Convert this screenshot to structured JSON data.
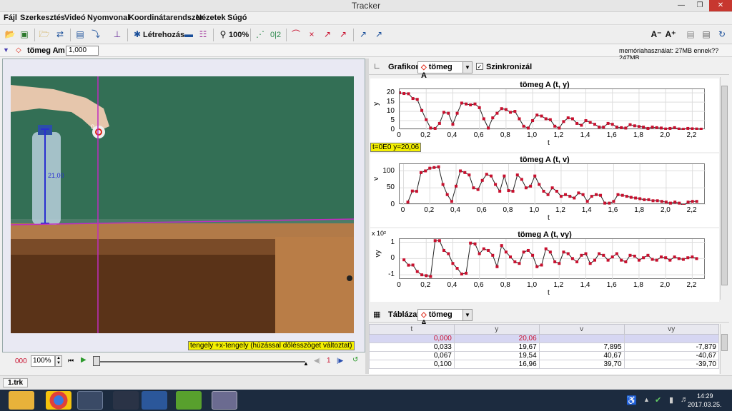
{
  "window": {
    "title": "Tracker",
    "tab": "1.trk"
  },
  "menu": [
    "Fájl",
    "Szerkesztés",
    "Videó",
    "Nyomvonal",
    "Koordinátarendszer",
    "Nézetek",
    "Súgó"
  ],
  "toolbar": {
    "create_label": "Létrehozás",
    "zoom_label": "100%",
    "superscript_label": "0|2"
  },
  "trackbar": {
    "track_name": "tömeg A",
    "mass_label": "m",
    "mass_value": "1,000",
    "memory_text": "memóriahasználat: 27MB ennek?? 247MB"
  },
  "video": {
    "point_label": "0",
    "length_label": "21,00",
    "axis_tooltip": "tengely +x-tengely (húzással dőlésszöget változtat)"
  },
  "controls": {
    "frame_counter": "000",
    "zoom_value": "100%",
    "step_value": "1"
  },
  "graph_panel": {
    "header_label": "Grafikon",
    "track": "tömeg A",
    "sync_label": "Szinkronizál",
    "readout": "t=0E0  y=20,06"
  },
  "chart_data": [
    {
      "type": "line",
      "title": "tömeg A (t, y)",
      "xlabel": "t",
      "ylabel": "y",
      "xlim": [
        0,
        2.3
      ],
      "ylim": [
        0,
        22
      ],
      "yticks": [
        "20",
        "15",
        "10",
        "5",
        "0"
      ],
      "ytick_values": [
        20,
        15,
        10,
        5,
        0
      ],
      "xticks": [
        "0",
        "0,2",
        "0,4",
        "0,6",
        "0,8",
        "1,0",
        "1,2",
        "1,4",
        "1,6",
        "1,8",
        "2,0",
        "2,2"
      ],
      "xtick_values": [
        0,
        0.2,
        0.4,
        0.6,
        0.8,
        1.0,
        1.2,
        1.4,
        1.6,
        1.8,
        2.0,
        2.2
      ],
      "x": [
        0,
        0.033,
        0.067,
        0.1,
        0.133,
        0.167,
        0.2,
        0.233,
        0.267,
        0.3,
        0.333,
        0.367,
        0.4,
        0.433,
        0.467,
        0.5,
        0.533,
        0.567,
        0.6,
        0.633,
        0.667,
        0.7,
        0.733,
        0.767,
        0.8,
        0.833,
        0.867,
        0.9,
        0.933,
        0.967,
        1.0,
        1.033,
        1.067,
        1.1,
        1.133,
        1.167,
        1.2,
        1.233,
        1.267,
        1.3,
        1.333,
        1.367,
        1.4,
        1.433,
        1.467,
        1.5,
        1.533,
        1.567,
        1.6,
        1.633,
        1.667,
        1.7,
        1.733,
        1.767,
        1.8,
        1.833,
        1.867,
        1.9,
        1.933,
        1.967,
        2.0,
        2.033,
        2.067,
        2.1,
        2.133,
        2.167,
        2.2,
        2.233,
        2.267
      ],
      "values": [
        20.06,
        19.67,
        19.54,
        16.96,
        16.5,
        10.5,
        5.5,
        1.0,
        0.8,
        3.5,
        9.5,
        9.0,
        3.0,
        9.0,
        14.5,
        14.0,
        13.5,
        14.0,
        12.0,
        6.0,
        1.0,
        6.5,
        9.0,
        11.5,
        11.0,
        9.5,
        10.0,
        6.0,
        2.0,
        1.0,
        5.0,
        8.0,
        7.5,
        6.0,
        5.5,
        2.0,
        1.0,
        4.5,
        6.5,
        6.0,
        3.5,
        2.5,
        5.0,
        4.0,
        3.0,
        1.5,
        1.5,
        3.5,
        3.0,
        1.5,
        1.2,
        1.0,
        2.8,
        2.2,
        1.8,
        1.5,
        0.8,
        1.5,
        1.2,
        1.0,
        0.5,
        0.8,
        1.2,
        0.5,
        0.3,
        0.8,
        0.6,
        0.5,
        0.4
      ]
    },
    {
      "type": "line",
      "title": "tömeg A (t, v)",
      "xlabel": "t",
      "ylabel": "v",
      "xlim": [
        -0.03,
        2.3
      ],
      "ylim": [
        0,
        120
      ],
      "yticks": [
        "100",
        "50",
        "0"
      ],
      "ytick_values": [
        100,
        50,
        0
      ],
      "xticks": [
        "0",
        "0,2",
        "0,4",
        "0,6",
        "0,8",
        "1,0",
        "1,2",
        "1,4",
        "1,6",
        "1,8",
        "2,0",
        "2,2"
      ],
      "xtick_values": [
        0,
        0.2,
        0.4,
        0.6,
        0.8,
        1.0,
        1.2,
        1.4,
        1.6,
        1.8,
        2.0,
        2.2
      ],
      "x": [
        0.033,
        0.067,
        0.1,
        0.133,
        0.167,
        0.2,
        0.233,
        0.267,
        0.3,
        0.333,
        0.367,
        0.4,
        0.433,
        0.467,
        0.5,
        0.533,
        0.567,
        0.6,
        0.633,
        0.667,
        0.7,
        0.733,
        0.767,
        0.8,
        0.833,
        0.867,
        0.9,
        0.933,
        0.967,
        1.0,
        1.033,
        1.067,
        1.1,
        1.133,
        1.167,
        1.2,
        1.233,
        1.267,
        1.3,
        1.333,
        1.367,
        1.4,
        1.433,
        1.467,
        1.5,
        1.533,
        1.567,
        1.6,
        1.633,
        1.667,
        1.7,
        1.733,
        1.767,
        1.8,
        1.833,
        1.867,
        1.9,
        1.933,
        1.967,
        2.0,
        2.033,
        2.067,
        2.1,
        2.133,
        2.167,
        2.2,
        2.233
      ],
      "values": [
        7.895,
        40.67,
        39.7,
        95.0,
        100.0,
        108.0,
        110.0,
        112.0,
        60.0,
        30.0,
        10.0,
        55.0,
        100.0,
        95.0,
        88.0,
        50.0,
        45.0,
        72.0,
        90.0,
        85.0,
        60.0,
        40.0,
        85.0,
        42.0,
        40.0,
        88.0,
        75.0,
        50.0,
        55.0,
        85.0,
        60.0,
        40.0,
        30.0,
        50.0,
        40.0,
        25.0,
        30.0,
        25.0,
        20.0,
        35.0,
        30.0,
        10.0,
        25.0,
        30.0,
        28.0,
        5.0,
        5.0,
        10.0,
        30.0,
        28.0,
        25.0,
        22.0,
        20.0,
        18.0,
        15.0,
        15.0,
        12.0,
        12.0,
        10.0,
        8.0,
        5.0,
        8.0,
        5.0,
        -2.0,
        8.0,
        10.0,
        10.0
      ]
    },
    {
      "type": "line",
      "title": "tömeg A (t, vy)",
      "xlabel": "t",
      "ylabel": "vy",
      "scale_label": "x 10²",
      "xlim": [
        0,
        2.3
      ],
      "ylim": [
        -1.3,
        1.2
      ],
      "yticks": [
        "1",
        "0",
        "-1"
      ],
      "ytick_values": [
        1,
        0,
        -1
      ],
      "xticks": [
        "0",
        "0,2",
        "0,4",
        "0,6",
        "0,8",
        "1,0",
        "1,2",
        "1,4",
        "1,6",
        "1,8",
        "2,0",
        "2,2"
      ],
      "xtick_values": [
        0,
        0.2,
        0.4,
        0.6,
        0.8,
        1.0,
        1.2,
        1.4,
        1.6,
        1.8,
        2.0,
        2.2
      ],
      "x": [
        0.033,
        0.067,
        0.1,
        0.133,
        0.167,
        0.2,
        0.233,
        0.267,
        0.3,
        0.333,
        0.367,
        0.4,
        0.433,
        0.467,
        0.5,
        0.533,
        0.567,
        0.6,
        0.633,
        0.667,
        0.7,
        0.733,
        0.767,
        0.8,
        0.833,
        0.867,
        0.9,
        0.933,
        0.967,
        1.0,
        1.033,
        1.067,
        1.1,
        1.133,
        1.167,
        1.2,
        1.233,
        1.267,
        1.3,
        1.333,
        1.367,
        1.4,
        1.433,
        1.467,
        1.5,
        1.533,
        1.567,
        1.6,
        1.633,
        1.667,
        1.7,
        1.733,
        1.767,
        1.8,
        1.833,
        1.867,
        1.9,
        1.933,
        1.967,
        2.0,
        2.033,
        2.067,
        2.1,
        2.133,
        2.167,
        2.2,
        2.233
      ],
      "values": [
        -0.079,
        -0.407,
        -0.397,
        -0.8,
        -1.0,
        -1.05,
        -1.1,
        1.1,
        1.1,
        0.5,
        0.3,
        -0.3,
        -0.6,
        -0.95,
        -0.9,
        0.95,
        0.9,
        0.3,
        0.6,
        0.5,
        0.2,
        -0.5,
        0.8,
        0.4,
        0.1,
        -0.2,
        -0.3,
        0.4,
        0.5,
        0.2,
        -0.5,
        -0.4,
        0.6,
        0.4,
        -0.2,
        -0.3,
        0.4,
        0.3,
        0.0,
        -0.2,
        0.2,
        0.3,
        -0.3,
        -0.1,
        0.3,
        0.2,
        -0.1,
        0.1,
        0.3,
        -0.1,
        -0.2,
        0.2,
        0.15,
        -0.1,
        0.05,
        0.2,
        -0.05,
        -0.1,
        0.1,
        0.05,
        -0.1,
        0.1,
        0.0,
        -0.05,
        0.05,
        0.1,
        0.0
      ]
    }
  ],
  "table_panel": {
    "header_label": "Táblázat",
    "track": "tömeg A",
    "columns": [
      "t",
      "y",
      "v",
      "vy"
    ],
    "rows": [
      [
        "0,000",
        "20,06",
        "",
        ""
      ],
      [
        "0,033",
        "19,67",
        "7,895",
        "-7,879"
      ],
      [
        "0,067",
        "19,54",
        "40,67",
        "-40,67"
      ],
      [
        "0,100",
        "16,96",
        "39,70",
        "-39,70"
      ]
    ]
  },
  "taskbar": {
    "time": "14:29",
    "date": "2017.03.25."
  }
}
